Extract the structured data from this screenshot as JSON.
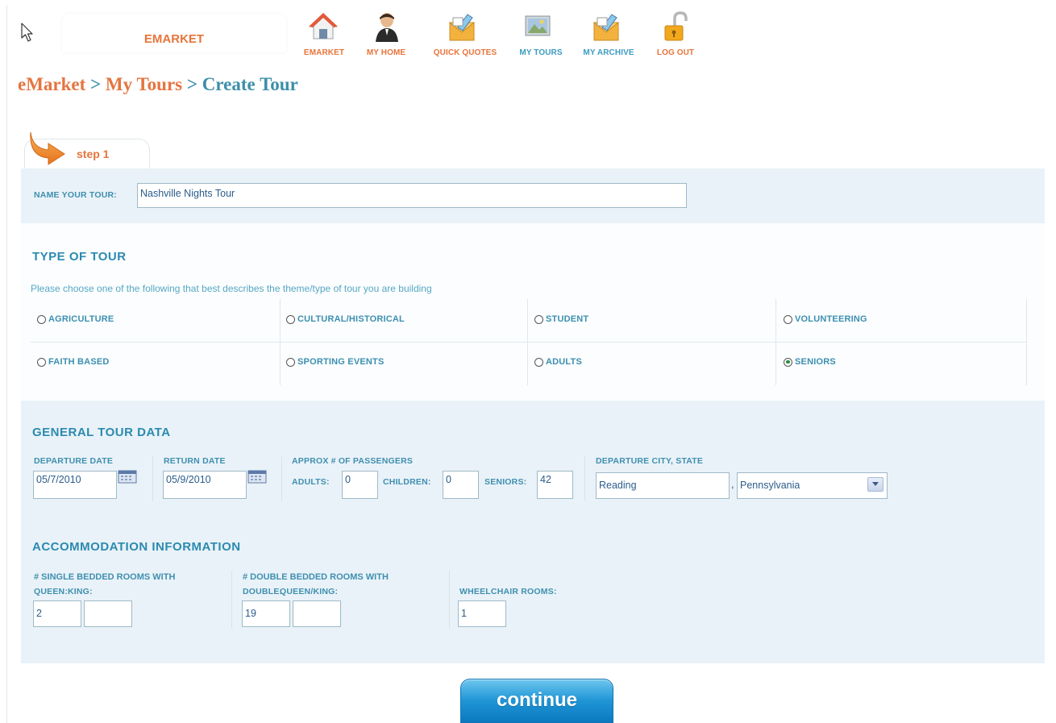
{
  "brand": {
    "tab_label": "EMARKET"
  },
  "nav": [
    {
      "label": "EMARKET",
      "icon": "home-icon",
      "color": "#e8743a"
    },
    {
      "label": "MY HOME",
      "icon": "user-icon",
      "color": "#e8743a"
    },
    {
      "label": "QUICK QUOTES",
      "icon": "envelope-icon",
      "color": "#e8743a"
    },
    {
      "label": "MY TOURS",
      "icon": "picture-icon",
      "color": "#3c9cc0"
    },
    {
      "label": "MY ARCHIVE",
      "icon": "envelope-icon",
      "color": "#3c9cc0"
    },
    {
      "label": "LOG OUT",
      "icon": "padlock-icon",
      "color": "#e8743a"
    }
  ],
  "breadcrumb": {
    "item1": "eMarket",
    "item2": "My Tours",
    "item3": "Create Tour",
    "separator": ">"
  },
  "step": {
    "label": "step 1"
  },
  "tour_name": {
    "label": "NAME YOUR TOUR:",
    "value": "Nashville Nights Tour"
  },
  "type_of_tour": {
    "heading": "TYPE OF TOUR",
    "description": "Please choose one of the following that best describes the theme/type of tour you are building",
    "options": [
      {
        "label": "AGRICULTURE",
        "selected": false
      },
      {
        "label": "CULTURAL/HISTORICAL",
        "selected": false
      },
      {
        "label": "STUDENT",
        "selected": false
      },
      {
        "label": "VOLUNTEERING",
        "selected": false
      },
      {
        "label": "FAITH BASED",
        "selected": false
      },
      {
        "label": "SPORTING EVENTS",
        "selected": false
      },
      {
        "label": "ADULTS",
        "selected": false
      },
      {
        "label": "SENIORS",
        "selected": true
      }
    ]
  },
  "general": {
    "heading": "GENERAL TOUR DATA",
    "departure_label": "DEPARTURE DATE",
    "departure_value": "05/7/2010",
    "return_label": "RETURN DATE",
    "return_value": "05/9/2010",
    "passengers_label": "APPROX # OF PASSENGERS",
    "adults_label": "ADULTS:",
    "adults_value": "0",
    "children_label": "CHILDREN:",
    "children_value": "0",
    "seniors_label": "SENIORS:",
    "seniors_value": "42",
    "city_label": "DEPARTURE CITY, STATE",
    "city_value": "Reading",
    "comma": ",",
    "state_value": "Pennsylvania"
  },
  "accommodation": {
    "heading": "ACCOMMODATION INFORMATION",
    "single_label": "# SINGLE BEDDED ROOMS WITH",
    "single_queen_label": "QUEEN:",
    "single_king_label": "KING:",
    "single_queen_value": "2",
    "single_king_value": "",
    "double_label": "# DOUBLE BEDDED ROOMS WITH",
    "double_double_label": "DOUBLE:",
    "double_qk_label": "QUEEN/KING:",
    "double_double_value": "19",
    "double_qk_value": "",
    "wheelchair_label": "WHEELCHAIR ROOMS:",
    "wheelchair_value": "1"
  },
  "continue_label": "continue"
}
